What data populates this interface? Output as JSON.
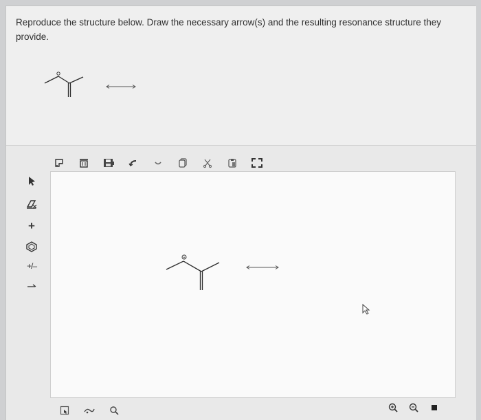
{
  "question": {
    "prompt": "Reproduce the structure below. Draw the necessary arrow(s) and the resulting resonance structure they provide."
  },
  "toolbar_top": {
    "items": [
      {
        "name": "new-document-icon"
      },
      {
        "name": "clear-icon"
      },
      {
        "name": "save-icon"
      },
      {
        "name": "undo-icon"
      },
      {
        "name": "redo-icon"
      },
      {
        "name": "copy-icon"
      },
      {
        "name": "cut-icon"
      },
      {
        "name": "paste-icon"
      },
      {
        "name": "fullscreen-icon"
      }
    ]
  },
  "toolbar_left": {
    "items": [
      {
        "name": "select-arrow-icon"
      },
      {
        "name": "eraser-icon"
      },
      {
        "name": "add-bond-icon",
        "glyph": "+"
      },
      {
        "name": "ring-template-icon"
      },
      {
        "name": "charge-icon",
        "glyph": "+/–"
      },
      {
        "name": "arrow-tool-icon"
      }
    ]
  },
  "toolbar_bottom": {
    "items": [
      {
        "name": "element-picker-icon"
      },
      {
        "name": "group-icon"
      },
      {
        "name": "search-template-icon"
      }
    ]
  },
  "toolbar_zoom": {
    "items": [
      {
        "name": "zoom-in-icon"
      },
      {
        "name": "zoom-out-icon"
      },
      {
        "name": "stop-icon"
      }
    ]
  },
  "molecule": {
    "charge_symbol": "+",
    "arrow": "resonance-double-headed-arrow"
  }
}
